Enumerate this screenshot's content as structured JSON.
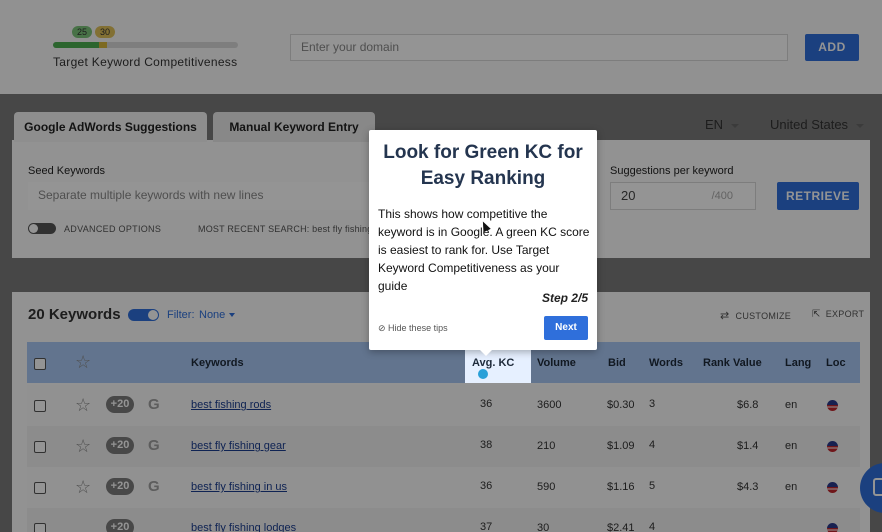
{
  "top": {
    "kc_values": [
      "25",
      "30"
    ],
    "kc_label": "Target Keyword Competitiveness",
    "domain_placeholder": "Enter your domain",
    "add_label": "ADD"
  },
  "tabs": [
    "Google AdWords Suggestions",
    "Manual Keyword Entry"
  ],
  "language": "EN",
  "country": "United States",
  "seed": {
    "label": "Seed Keywords",
    "placeholder": "Separate multiple keywords with new lines",
    "advanced_label": "ADVANCED OPTIONS",
    "recent_search": "MOST RECENT SEARCH: best fly fishing"
  },
  "suggestions": {
    "label": "Suggestions per keyword",
    "value": "20",
    "max": "/400",
    "retrieve_label": "RETRIEVE"
  },
  "results": {
    "count_label": "20 Keywords",
    "filter_label": "Filter:",
    "filter_value": "None",
    "customize_label": "CUSTOMIZE",
    "export_label": "EXPORT"
  },
  "table": {
    "headers": [
      "Keywords",
      "Avg. KC",
      "Volume",
      "Bid",
      "Words",
      "Rank Value",
      "Lang",
      "Loc"
    ],
    "rows": [
      {
        "plus": "+20",
        "keyword": "best fishing rods",
        "kc": "36",
        "volume": "3600",
        "bid": "$0.30",
        "words": "3",
        "rank_value": "$6.8",
        "lang": "en"
      },
      {
        "plus": "+20",
        "keyword": "best fly fishing gear",
        "kc": "38",
        "volume": "210",
        "bid": "$1.09",
        "words": "4",
        "rank_value": "$1.4",
        "lang": "en"
      },
      {
        "plus": "+20",
        "keyword": "best fly fishing in us",
        "kc": "36",
        "volume": "590",
        "bid": "$1.16",
        "words": "5",
        "rank_value": "$4.3",
        "lang": "en"
      },
      {
        "plus": "+20",
        "keyword": "best fly fishing lodges",
        "kc": "37",
        "volume": "30",
        "bid": "$2.41",
        "words": "4",
        "rank_value": "",
        "lang": ""
      }
    ]
  },
  "tip": {
    "title": "Look for Green KC for Easy Ranking",
    "body": "This shows how competitive the keyword is in Google. A green KC score is easiest to rank for. Use Target Keyword Competitiveness as your guide",
    "step": "Step 2/5",
    "hide_label": "Hide these tips",
    "next_label": "Next"
  },
  "colors": {
    "accent": "#2f6fdb",
    "header_bg": "#a9c9f5",
    "toggle": "#2f6fdb"
  }
}
